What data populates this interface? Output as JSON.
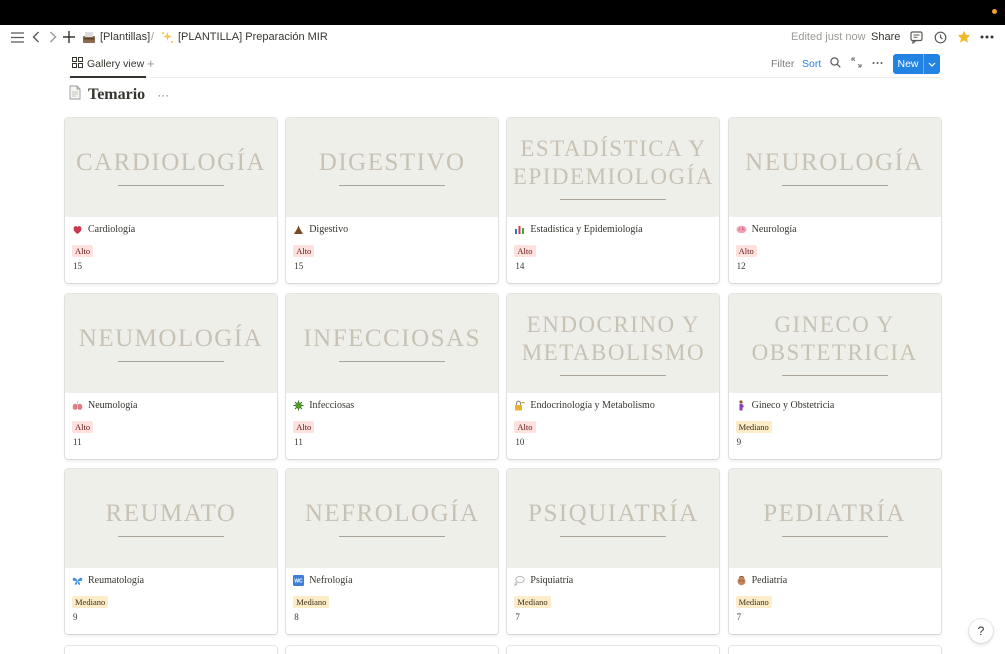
{
  "header": {
    "breadcrumb_1": "[Plantillas]",
    "separator": "/",
    "breadcrumb_2": "[PLANTILLA] Preparación MIR",
    "edited": "Edited just now",
    "share": "Share"
  },
  "viewbar": {
    "tab": "Gallery view",
    "filter": "Filter",
    "sort": "Sort",
    "new": "New"
  },
  "page": {
    "title": "Temario",
    "more": "···"
  },
  "cards": [
    {
      "cover": "CARDIOLOGÍA",
      "name": "Cardiología",
      "icon": "anatomical-heart",
      "tag": "Alto",
      "count": "15"
    },
    {
      "cover": "DIGESTIVO",
      "name": "Digestivo",
      "icon": "poop",
      "tag": "Alto",
      "count": "15"
    },
    {
      "cover": "ESTADÍSTICA Y EPIDEMIOLOGÍA",
      "name": "Estadística y Epidemiología",
      "icon": "bar-chart",
      "tag": "Alto",
      "count": "14"
    },
    {
      "cover": "NEUROLOGÍA",
      "name": "Neurología",
      "icon": "brain",
      "tag": "Alto",
      "count": "12"
    },
    {
      "cover": "NEUMOLOGÍA",
      "name": "Neumología",
      "icon": "lungs",
      "tag": "Alto",
      "count": "11"
    },
    {
      "cover": "INFECCIOSAS",
      "name": "Infecciosas",
      "icon": "microbe",
      "tag": "Alto",
      "count": "11"
    },
    {
      "cover": "ENDOCRINO Y METABOLISMO",
      "name": "Endocrinología y Metabolismo",
      "icon": "lock-key",
      "tag": "Alto",
      "count": "10"
    },
    {
      "cover": "GINECO Y OBSTETRICIA",
      "name": "Gineco y Obstetricia",
      "icon": "pregnant-woman",
      "tag": "Mediano",
      "count": "9"
    },
    {
      "cover": "REUMATO",
      "name": "Reumatología",
      "icon": "butterfly",
      "tag": "Mediano",
      "count": "9"
    },
    {
      "cover": "NEFROLOGÍA",
      "name": "Nefrología",
      "icon": "wc",
      "tag": "Mediano",
      "count": "8"
    },
    {
      "cover": "PSIQUIATRÍA",
      "name": "Psiquiatría",
      "icon": "thought-balloon",
      "tag": "Mediano",
      "count": "7"
    },
    {
      "cover": "PEDIATRÍA",
      "name": "Pediatría",
      "icon": "baby-bottle",
      "tag": "Mediano",
      "count": "7"
    }
  ],
  "colors": {
    "accent": "#2383e2",
    "alto_bg": "#ffe2dd",
    "mediano_bg": "#fdecc8",
    "cover_bg": "#efefea",
    "cover_text": "#c7c2b4"
  },
  "help": "?"
}
